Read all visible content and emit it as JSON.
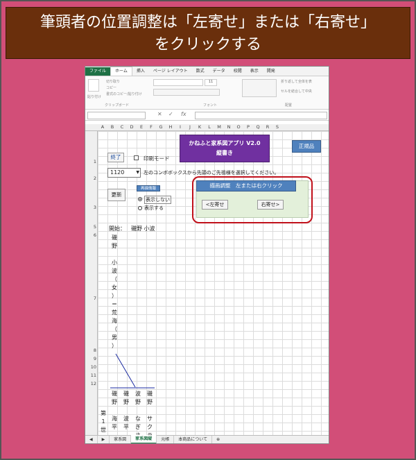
{
  "banner": {
    "line1": "筆頭者の位置調整は「左寄せ」または「右寄せ」",
    "line2": "をクリックする"
  },
  "excel": {
    "ribbon_tabs": [
      "ファイル",
      "ホーム",
      "挿入",
      "ページ レイアウト",
      "数式",
      "データ",
      "校閲",
      "表示",
      "開発"
    ],
    "ribbon_groups": {
      "clipboard": "クリップボード",
      "font": "フォント",
      "align": "配置"
    },
    "ribbon_items": {
      "paste": "貼り付け",
      "cut": "切り取り",
      "copy": "コピー",
      "format_painter": "書式のコピー/貼り付け",
      "wrap": "折り返して全体を表",
      "merge": "セルを結合して中央",
      "font_size": "11"
    },
    "fx": "fx",
    "columns": [
      "A",
      "B",
      "C",
      "D",
      "E",
      "F",
      "G",
      "H",
      "I",
      "J",
      "K",
      "L",
      "M",
      "N",
      "O",
      "P",
      "Q",
      "R",
      "S"
    ],
    "rows": [
      "1",
      "2",
      "3",
      "5",
      "6",
      "7",
      "8",
      "9",
      "10",
      "11",
      "12"
    ],
    "sheet_tabs": [
      "家系図",
      "家系図縦",
      "元帳",
      "本商品について"
    ],
    "active_sheet_index": 1
  },
  "app": {
    "title": "かねふと家系図アプリ V2.0",
    "subtitle": "縦書き",
    "seihin_button": "正規品",
    "end_button": "終了",
    "print_mode_label": "印刷モード",
    "combo_value": "1120",
    "combo_instruction": "左のコンボボックスから先頭のご先祖様を選択してください。",
    "update_button": "更新",
    "reinfo_button": "再描情報",
    "radio_hide": "表示しない",
    "radio_show": "表示する",
    "adjust_button": "描画調整　左または右クリック",
    "left_button": "<左寄せ",
    "right_button": "右寄せ>",
    "start_label": "開始：",
    "start_name": "磯野 小波",
    "root_vertical": "磯\n野\n\n小\n波\n（\n女\n）\n＝\n荒\n海\n（\n男\n）",
    "children": [
      "磯\n野\n\n海\n平",
      "磯\n野\n\n波\n平",
      "波\n野\n\nな\nぎ\nさ",
      "磯\n野\n\nサ\nク\nラ"
    ],
    "generation_label": "第\n1\n世"
  },
  "colors": {
    "background": "#d24e78",
    "banner": "#6a2f0c",
    "purple_title": "#7030a0",
    "blue_button": "#4f81bd",
    "panel_green": "#e3f0da",
    "highlight_ring": "#c0101a"
  }
}
